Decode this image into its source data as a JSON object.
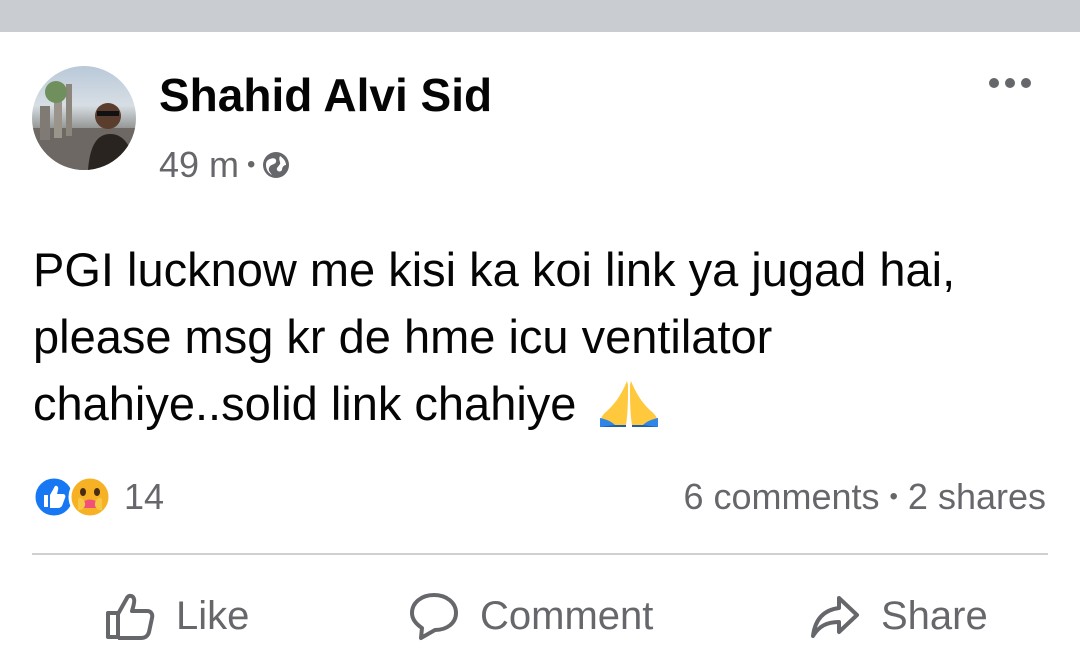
{
  "post": {
    "author": "Shahid Alvi Sid",
    "time": "49 m",
    "meta_separator": "•",
    "audience_icon": "globe-icon",
    "text": "PGI lucknow me kisi ka koi link ya jugad hai, please msg kr de hme icu ventilator chahiye..solid link chahiye",
    "emoji": "folded-hands-emoji"
  },
  "engagement": {
    "reaction_icons": [
      "like-reaction-icon",
      "care-reaction-icon"
    ],
    "reaction_count": "14",
    "comments": "6 comments",
    "separator": "•",
    "shares": "2 shares"
  },
  "actions": {
    "like": "Like",
    "comment": "Comment",
    "share": "Share"
  },
  "colors": {
    "top_bar": "#c9ccd1",
    "secondary_text": "#65676b",
    "like_blue": "#1877f2",
    "divider": "#ced0d4"
  }
}
